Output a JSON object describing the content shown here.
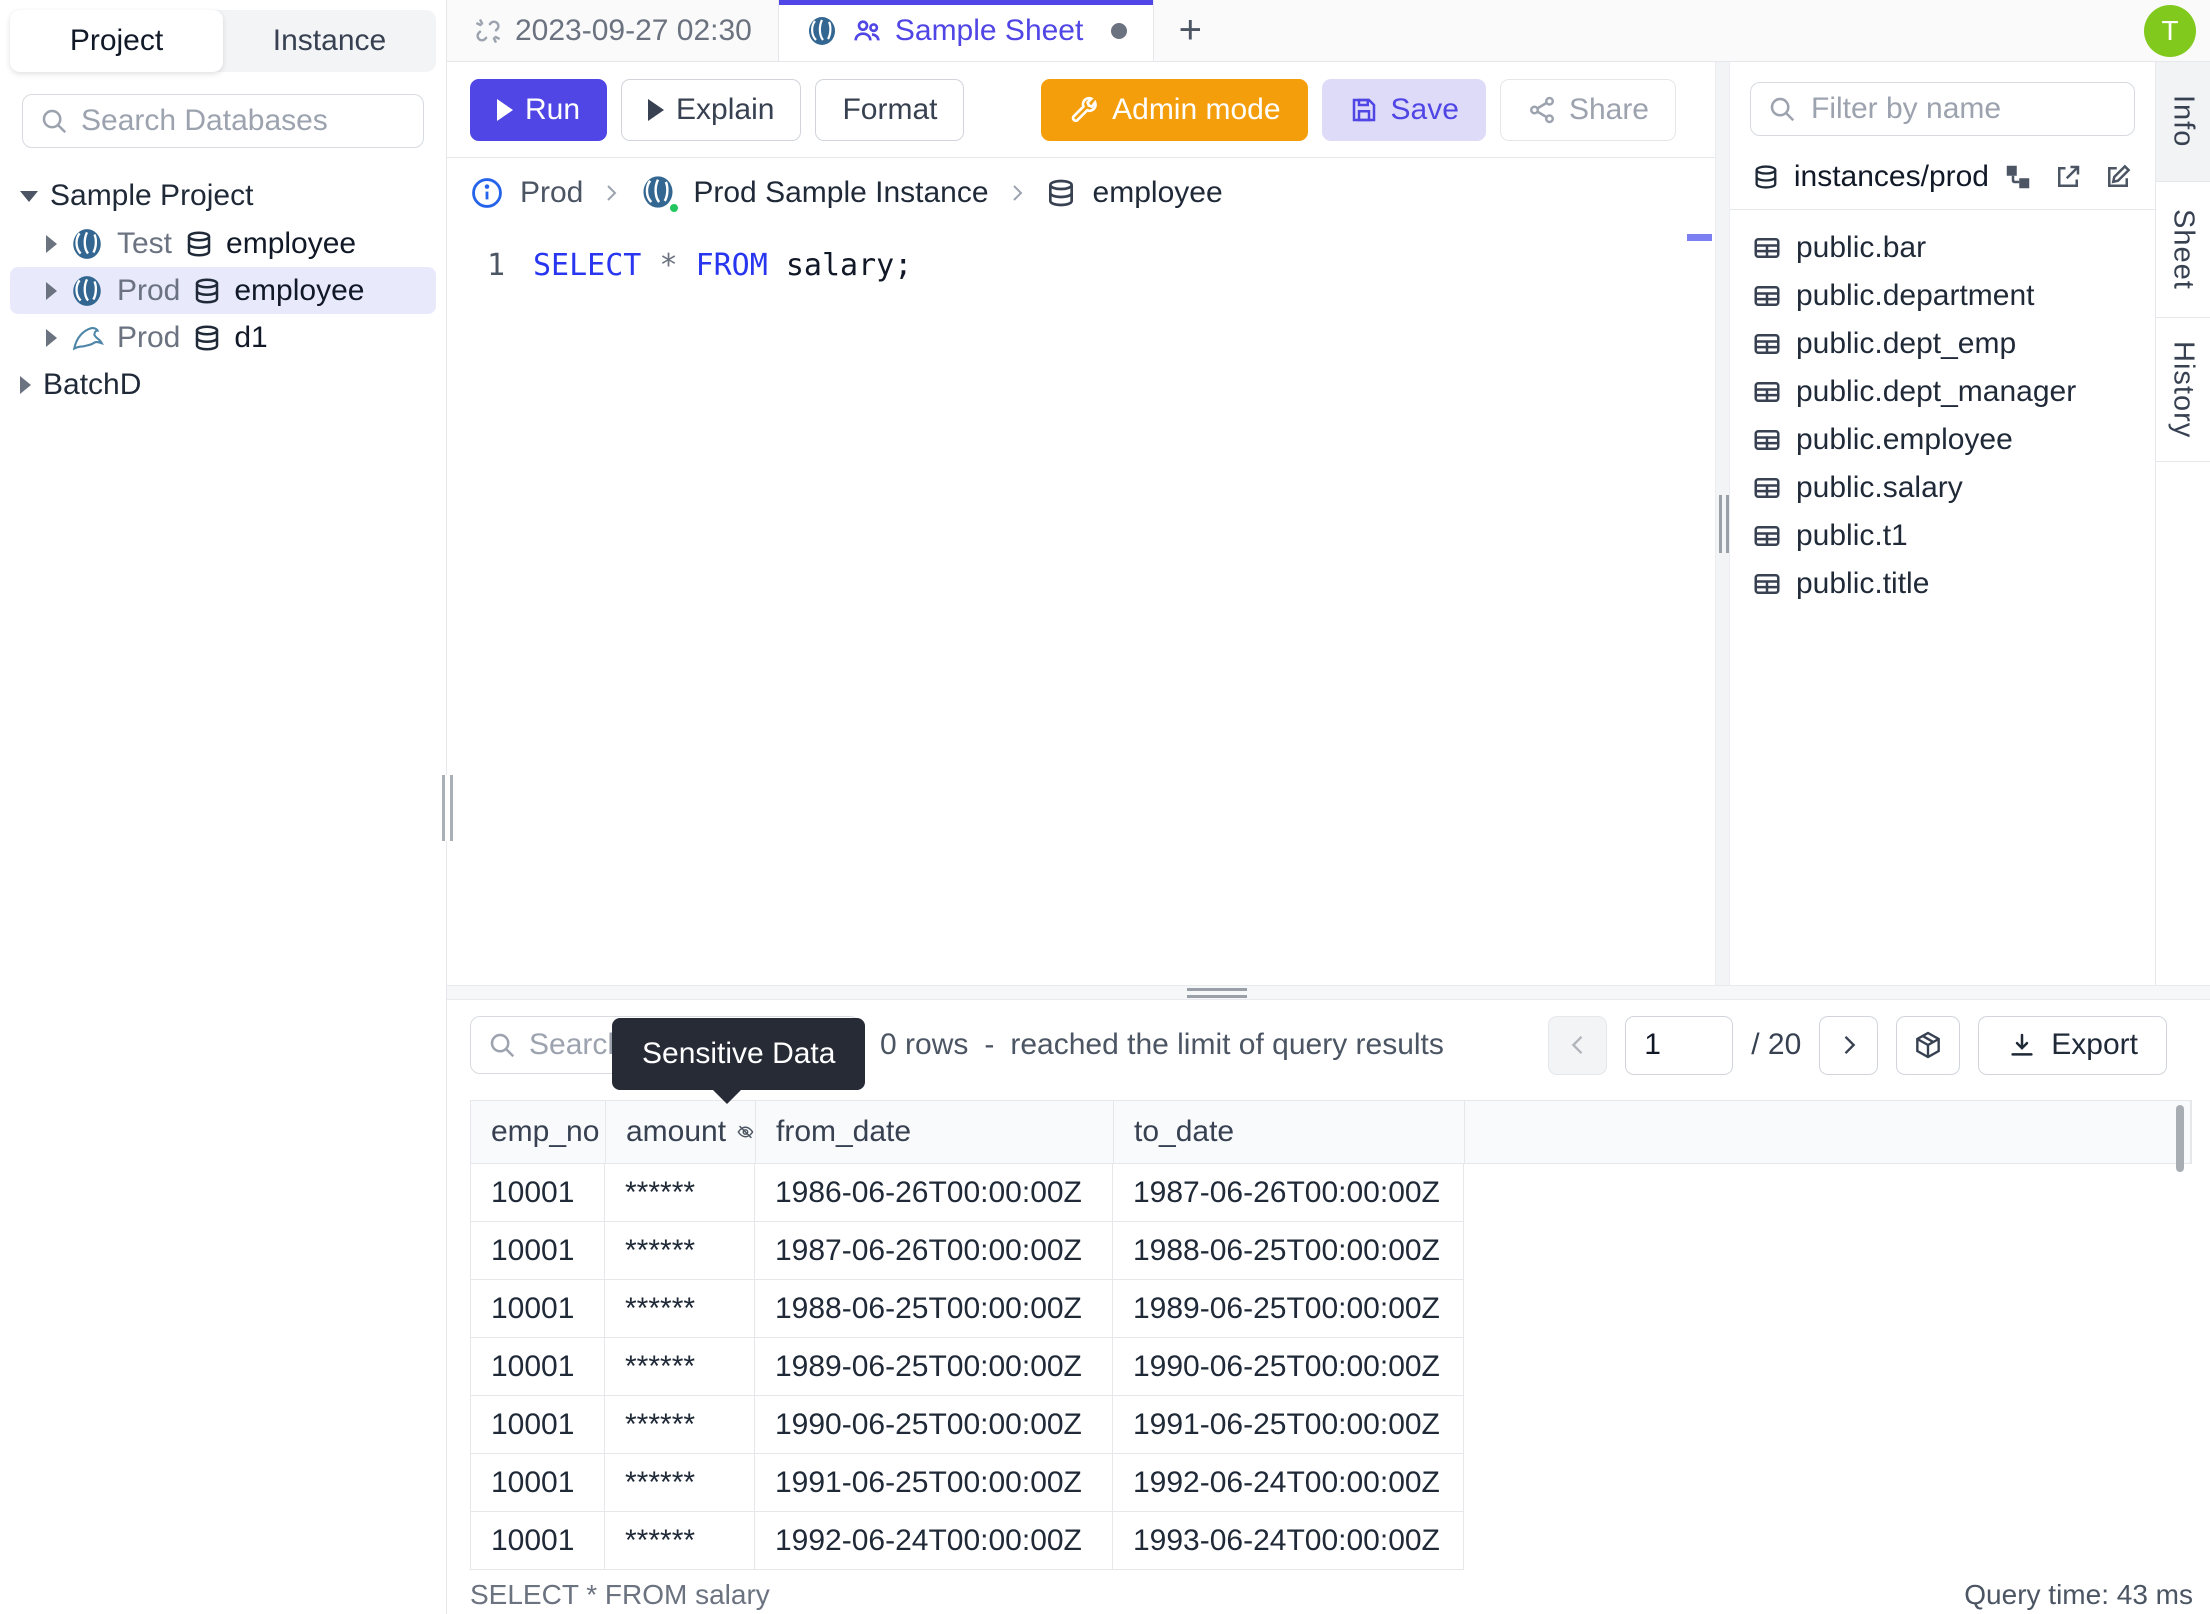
{
  "colors": {
    "accent_indigo": "#4f46e5",
    "admin_orange": "#f59e0b",
    "avatar_green": "#82c91e",
    "keyword_blue": "#2936f0",
    "instance_status_green": "#22c55e"
  },
  "sidebar": {
    "tabs": {
      "project": "Project",
      "instance": "Instance"
    },
    "search_placeholder": "Search Databases",
    "tree": {
      "root": "Sample Project",
      "items": [
        {
          "env": "Test",
          "db": "employee"
        },
        {
          "env": "Prod",
          "db": "employee"
        },
        {
          "env": "Prod",
          "db": "d1"
        }
      ],
      "group": "BatchD"
    }
  },
  "tabbar": {
    "history_tab": "2023-09-27 02:30",
    "active_tab": "Sample Sheet",
    "new_tab": "+",
    "avatar": "T"
  },
  "toolbar": {
    "run": "Run",
    "explain": "Explain",
    "format": "Format",
    "admin_mode": "Admin mode",
    "save": "Save",
    "share": "Share"
  },
  "breadcrumb": {
    "env": "Prod",
    "instance": "Prod Sample Instance",
    "database": "employee"
  },
  "editor": {
    "line_number": "1",
    "kw_select": "SELECT",
    "star": "*",
    "kw_from": "FROM",
    "rest": "salary;"
  },
  "right_panel": {
    "filter_placeholder": "Filter by name",
    "header": "instances/prod",
    "tables": [
      "public.bar",
      "public.department",
      "public.dept_emp",
      "public.dept_manager",
      "public.employee",
      "public.salary",
      "public.t1",
      "public.title"
    ]
  },
  "side_tabs": {
    "info": "Info",
    "sheet": "Sheet",
    "history": "History"
  },
  "results": {
    "search_placeholder": "Search",
    "tooltip": "Sensitive Data",
    "rows_count": "0 rows",
    "dash": "-",
    "limit_note": "reached the limit of query results",
    "pagination": {
      "page": "1",
      "total": "/ 20"
    },
    "export": "Export",
    "columns": {
      "c0": "emp_no",
      "c1": "amount",
      "c2": "from_date",
      "c3": "to_date"
    },
    "rows": [
      [
        "10001",
        "******",
        "1986-06-26T00:00:00Z",
        "1987-06-26T00:00:00Z"
      ],
      [
        "10001",
        "******",
        "1987-06-26T00:00:00Z",
        "1988-06-25T00:00:00Z"
      ],
      [
        "10001",
        "******",
        "1988-06-25T00:00:00Z",
        "1989-06-25T00:00:00Z"
      ],
      [
        "10001",
        "******",
        "1989-06-25T00:00:00Z",
        "1990-06-25T00:00:00Z"
      ],
      [
        "10001",
        "******",
        "1990-06-25T00:00:00Z",
        "1991-06-25T00:00:00Z"
      ],
      [
        "10001",
        "******",
        "1991-06-25T00:00:00Z",
        "1992-06-24T00:00:00Z"
      ],
      [
        "10001",
        "******",
        "1992-06-24T00:00:00Z",
        "1993-06-24T00:00:00Z"
      ]
    ]
  },
  "statusbar": {
    "left": "SELECT * FROM salary",
    "right": "Query time: 43 ms"
  }
}
